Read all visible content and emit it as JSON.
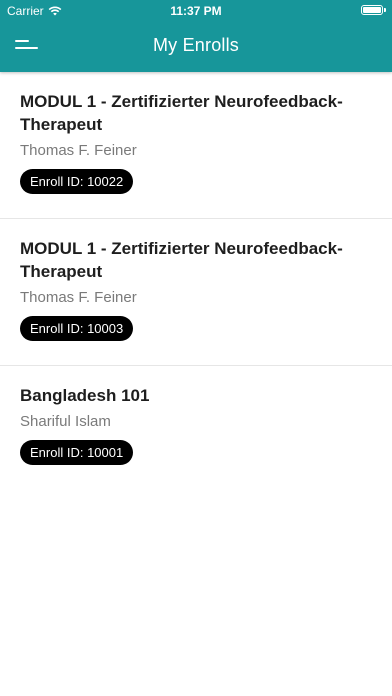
{
  "status_bar": {
    "carrier": "Carrier",
    "time": "11:37 PM"
  },
  "header": {
    "title": "My Enrolls",
    "background_color": "#17969a"
  },
  "enrollments": [
    {
      "course": "MODUL 1 - Zertifizierter Neurofeedback-Therapeut",
      "instructor": "Thomas F. Feiner",
      "enroll_id": "Enroll ID: 10022"
    },
    {
      "course": "MODUL 1 - Zertifizierter Neurofeedback-Therapeut",
      "instructor": "Thomas F. Feiner",
      "enroll_id": "Enroll ID: 10003"
    },
    {
      "course": "Bangladesh 101",
      "instructor": "Shariful Islam",
      "enroll_id": "Enroll ID: 10001"
    }
  ]
}
